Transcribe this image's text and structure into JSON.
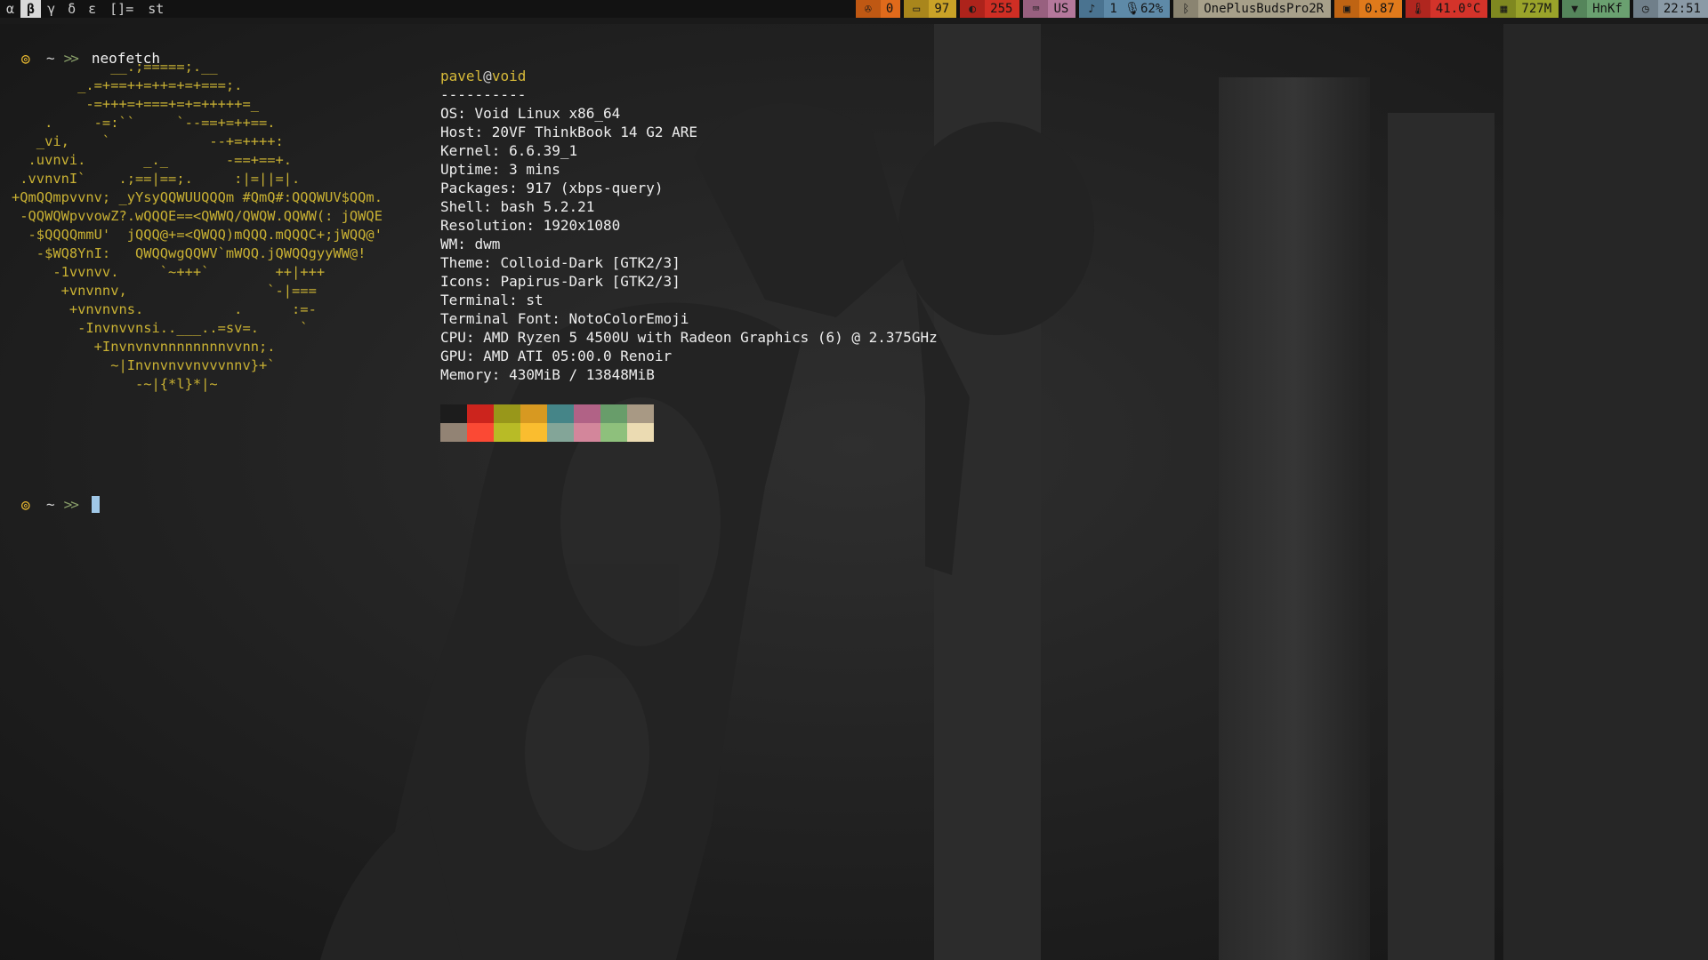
{
  "bar": {
    "tags": [
      "α",
      "β",
      "γ",
      "δ",
      "ε"
    ],
    "active_tag_index": 1,
    "layout": "[]=",
    "window_title": "st",
    "modules": [
      {
        "icon": "cpu-fan-icon",
        "value": "0",
        "bg": "#e06a1b",
        "icon_bg": "#bf5813"
      },
      {
        "icon": "battery-icon",
        "value": "97",
        "bg": "#c9a227",
        "icon_bg": "#a9861c"
      },
      {
        "icon": "brightness-icon",
        "value": "255",
        "bg": "#cf2e24",
        "icon_bg": "#ad231b"
      },
      {
        "icon": "keyboard-icon",
        "value": "US",
        "bg": "#b4789b",
        "icon_bg": "#98607f"
      },
      {
        "icon": "volume-icon",
        "value": "1 🎙62%",
        "bg": "#5e8aa8",
        "icon_bg": "#4a7390"
      },
      {
        "icon": "bluetooth-icon",
        "value": "OnePlusBudsPro2R",
        "bg": "#a7a08a",
        "icon_bg": "#8a8471"
      },
      {
        "icon": "cpu-load-icon",
        "value": "0.87",
        "bg": "#e07a1b",
        "icon_bg": "#bf6413"
      },
      {
        "icon": "temperature-icon",
        "value": "41.0°C",
        "bg": "#d4332a",
        "icon_bg": "#b0261f"
      },
      {
        "icon": "memory-icon",
        "value": "727M",
        "bg": "#9aa32a",
        "icon_bg": "#7f8820"
      },
      {
        "icon": "wifi-icon",
        "value": "HnKf",
        "bg": "#6aa070",
        "icon_bg": "#55855b"
      },
      {
        "icon": "clock-icon",
        "value": "22:51",
        "bg": "#8a9aa6",
        "icon_bg": "#707f8a"
      }
    ]
  },
  "terminal": {
    "prompt_symbol": "~",
    "prompt_arrows": ">>",
    "command": "neofetch",
    "logo": "            __.;=====;.__\n        _.=+==++=++=+=+===;.\n         -=+++=+===+=+=+++++=_\n    .     -=:``     `--==+=++==.\n   _vi,    `            --+=++++:\n  .uvnvi.       _._       -==+==+.\n .vvnvnI`    .;==|==;.     :|=||=|.\n+QmQQmpvvnv; _yYsyQQWUUQQQm #QmQ#:QQQWUV$QQm.\n -QQWQWpvvowZ?.wQQQE==<QWWQ/QWQW.QQWW(: jQWQE\n  -$QQQQmmU'  jQQQ@+=<QWQQ)mQQQ.mQQQC+;jWQQ@'\n   -$WQ8YnI:   QWQQwgQQWV`mWQQ.jQWQQgyyWW@!\n     -1vvnvv.     `~+++`        ++|+++\n      +vnvnnv,                 `-|===\n       +vnvnvns.           .      :=-\n        -Invnvvnsi..___..=sv=.     `\n          +Invnvnvnnnnnnnnvvnn;.\n            ~|Invnvnvvnvvvnnv}+`\n               -~|{*l}*|~",
    "user": "pavel",
    "at": "@",
    "host": "void",
    "separator": "----------",
    "info": [
      {
        "key": "OS",
        "value": "Void Linux x86_64"
      },
      {
        "key": "Host",
        "value": "20VF ThinkBook 14 G2 ARE"
      },
      {
        "key": "Kernel",
        "value": "6.6.39_1"
      },
      {
        "key": "Uptime",
        "value": "3 mins"
      },
      {
        "key": "Packages",
        "value": "917 (xbps-query)"
      },
      {
        "key": "Shell",
        "value": "bash 5.2.21"
      },
      {
        "key": "Resolution",
        "value": "1920x1080"
      },
      {
        "key": "WM",
        "value": "dwm"
      },
      {
        "key": "Theme",
        "value": "Colloid-Dark [GTK2/3]"
      },
      {
        "key": "Icons",
        "value": "Papirus-Dark [GTK2/3]"
      },
      {
        "key": "Terminal",
        "value": "st"
      },
      {
        "key": "Terminal Font",
        "value": "NotoColorEmoji"
      },
      {
        "key": "CPU",
        "value": "AMD Ryzen 5 4500U with Radeon Graphics (6) @ 2.375GHz"
      },
      {
        "key": "GPU",
        "value": "AMD ATI 05:00.0 Renoir"
      },
      {
        "key": "Memory",
        "value": "430MiB / 13848MiB"
      }
    ],
    "palette": [
      "#1c1c1c",
      "#cc241d",
      "#98971a",
      "#d79921",
      "#458588",
      "#b16286",
      "#689d6a",
      "#a89984",
      "#928374",
      "#fb4934",
      "#b8bb26",
      "#fabd2f",
      "#83a598",
      "#d3869b",
      "#8ec07c",
      "#ebdbb2"
    ]
  }
}
